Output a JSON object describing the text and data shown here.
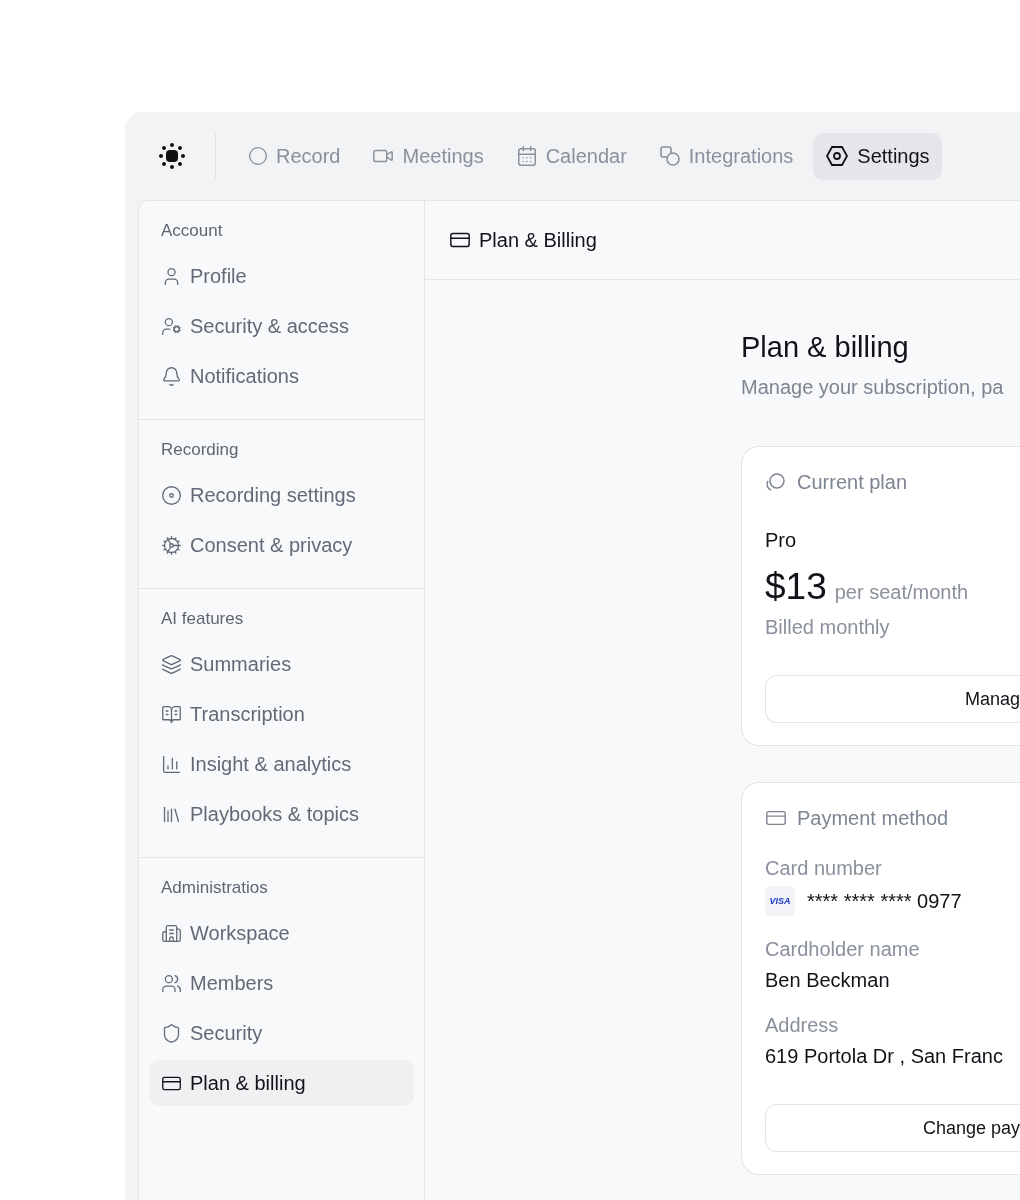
{
  "nav": {
    "items": [
      {
        "label": "Record",
        "selected": false
      },
      {
        "label": "Meetings",
        "selected": false
      },
      {
        "label": "Calendar",
        "selected": false
      },
      {
        "label": "Integrations",
        "selected": false
      },
      {
        "label": "Settings",
        "selected": true
      }
    ]
  },
  "sidebar": {
    "sections": [
      {
        "title": "Account",
        "items": [
          {
            "label": "Profile",
            "selected": false
          },
          {
            "label": "Security & access",
            "selected": false
          },
          {
            "label": "Notifications",
            "selected": false
          }
        ]
      },
      {
        "title": "Recording",
        "items": [
          {
            "label": "Recording settings",
            "selected": false
          },
          {
            "label": "Consent & privacy",
            "selected": false
          }
        ]
      },
      {
        "title": "AI features",
        "items": [
          {
            "label": "Summaries",
            "selected": false
          },
          {
            "label": "Transcription",
            "selected": false
          },
          {
            "label": "Insight & analytics",
            "selected": false
          },
          {
            "label": "Playbooks & topics",
            "selected": false
          }
        ]
      },
      {
        "title": "Administratios",
        "items": [
          {
            "label": "Workspace",
            "selected": false
          },
          {
            "label": "Members",
            "selected": false
          },
          {
            "label": "Security",
            "selected": false
          },
          {
            "label": "Plan & billing",
            "selected": true
          }
        ]
      }
    ]
  },
  "panel_header": {
    "title": "Plan & Billing"
  },
  "page": {
    "title": "Plan & billing",
    "subtitle": "Manage your subscription, pa"
  },
  "current_plan": {
    "title": "Current plan",
    "plan_name": "Pro",
    "price": "$13",
    "price_unit": "per seat/month",
    "billing": "Billed monthly",
    "button": "Manag"
  },
  "payment_method": {
    "title": "Payment method",
    "fields": [
      {
        "kind": "card",
        "label": "Card number",
        "brand": "VISA",
        "value": "**** **** **** 0977"
      },
      {
        "kind": "text",
        "label": "Cardholder name",
        "value": "Ben Beckman"
      },
      {
        "kind": "text",
        "label": "Address",
        "value": "619 Portola Dr , San Franc"
      }
    ],
    "button": "Change pay"
  }
}
